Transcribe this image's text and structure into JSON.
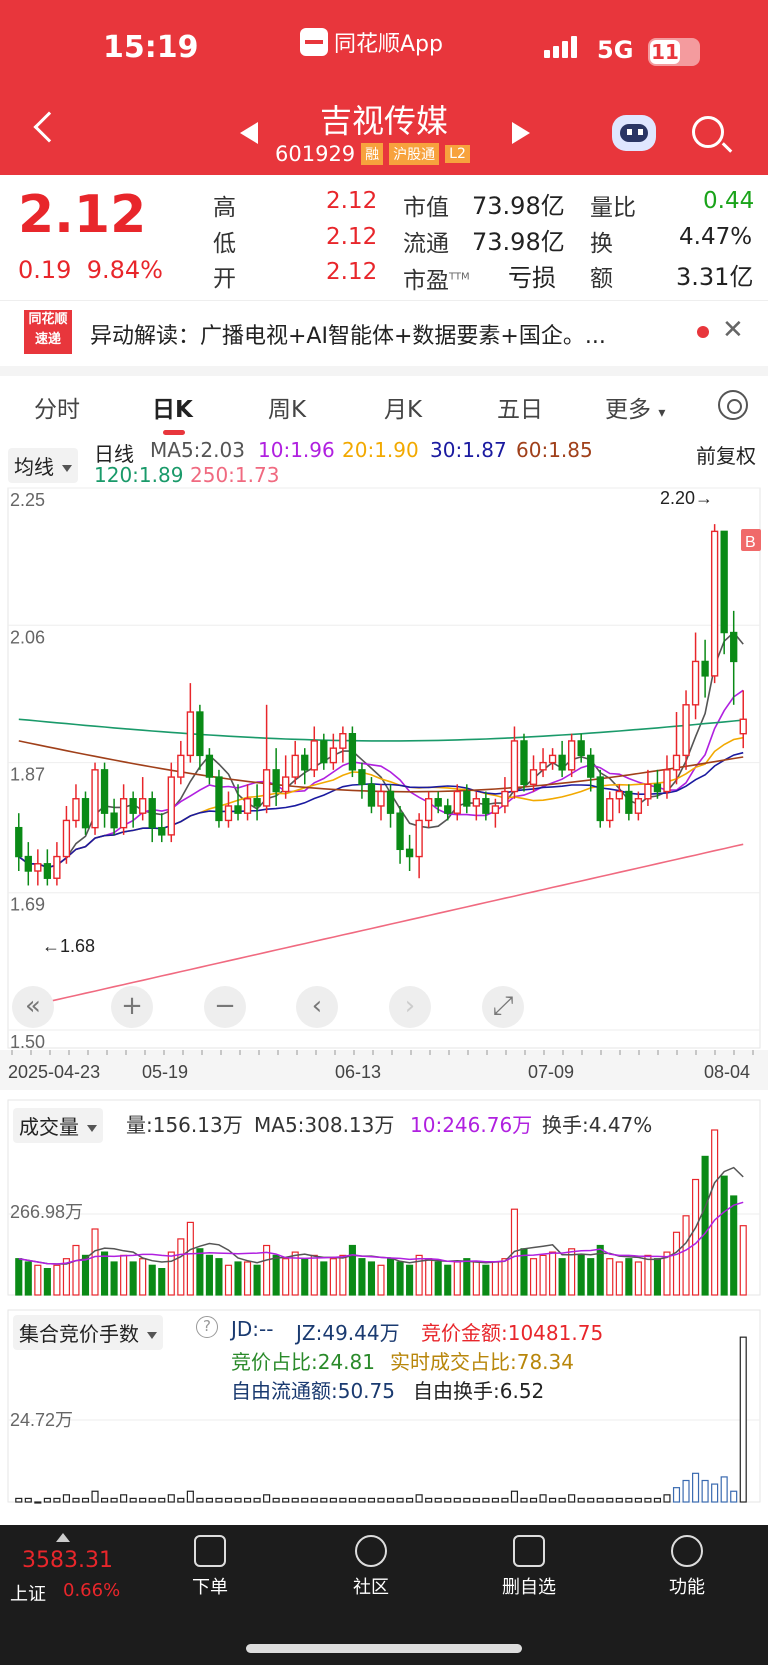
{
  "status": {
    "time": "15:19",
    "app_name": "同花顺App",
    "network": "5G",
    "battery": "11"
  },
  "stock": {
    "name": "吉视传媒",
    "code": "601929",
    "tags": [
      "融",
      "沪股通",
      "L2"
    ]
  },
  "quote": {
    "price": "2.12",
    "change": "0.19",
    "change_pct": "9.84%",
    "high_label": "高",
    "high": "2.12",
    "low_label": "低",
    "low": "2.12",
    "open_label": "开",
    "open": "2.12",
    "mcap_label": "市值",
    "mcap": "73.98亿",
    "float_label": "流通",
    "float": "73.98亿",
    "pe_label": "市盈",
    "pe_sup": "TTM",
    "pe": "亏损",
    "vr_label": "量比",
    "vr": "0.44",
    "turn_label": "换",
    "turn": "4.47%",
    "amt_label": "额",
    "amt": "3.31亿"
  },
  "news": {
    "logo_top": "同花顺",
    "logo_bottom": "速递",
    "text": "异动解读：广播电视+AI智能体+数据要素+国企。..."
  },
  "tabs": [
    "分时",
    "日K",
    "周K",
    "月K",
    "五日",
    "更多"
  ],
  "ma": {
    "selector": "均线",
    "period": "日线",
    "right": "前复权",
    "ma5": "MA5:2.03",
    "ma10": "10:1.96",
    "ma20": "20:1.90",
    "ma30": "30:1.87",
    "ma60": "60:1.85",
    "ma120": "120:1.89",
    "ma250": "250:1.73"
  },
  "kline": {
    "y_labels": [
      "2.25",
      "2.06",
      "1.87",
      "1.69",
      "1.50"
    ],
    "max_label": "2.20→",
    "min_label": "←1.68",
    "b_marker": "B",
    "dates": [
      "2025-04-23",
      "05-19",
      "06-13",
      "07-09",
      "08-04"
    ]
  },
  "volume": {
    "selector": "成交量",
    "vol": "量:156.13万",
    "ma5": "MA5:308.13万",
    "ma10": "10:246.76万",
    "turn": "换手:4.47%",
    "y_label": "266.98万"
  },
  "auction": {
    "selector": "集合竞价手数",
    "jd": "JD:--",
    "jz": "JZ:49.44万",
    "amount": "竞价金额:10481.75",
    "ratio": "竞价占比:24.81",
    "rt_ratio": "实时成交占比:78.34",
    "free_float": "自由流通额:50.75",
    "free_turn": "自由换手:6.52",
    "y_label": "24.72万"
  },
  "index": {
    "value": "3583.31",
    "name": "上证",
    "pct": "0.66%"
  },
  "nav": [
    "下单",
    "社区",
    "删自选",
    "功能"
  ],
  "colors": {
    "header": "#e8363c",
    "up": "#e8262b",
    "down": "#0a8a16"
  },
  "chart_data": {
    "type": "candlestick",
    "ylim": [
      1.5,
      2.25
    ],
    "max": 2.2,
    "min": 1.68,
    "candles": [
      [
        1.78,
        1.74,
        1.8,
        1.72
      ],
      [
        1.74,
        1.72,
        1.76,
        1.7
      ],
      [
        1.72,
        1.73,
        1.75,
        1.7
      ],
      [
        1.73,
        1.71,
        1.75,
        1.7
      ],
      [
        1.71,
        1.74,
        1.76,
        1.7
      ],
      [
        1.74,
        1.79,
        1.81,
        1.73
      ],
      [
        1.79,
        1.82,
        1.84,
        1.78
      ],
      [
        1.82,
        1.78,
        1.83,
        1.77
      ],
      [
        1.78,
        1.86,
        1.87,
        1.77
      ],
      [
        1.86,
        1.8,
        1.87,
        1.78
      ],
      [
        1.8,
        1.78,
        1.82,
        1.77
      ],
      [
        1.78,
        1.82,
        1.84,
        1.77
      ],
      [
        1.82,
        1.8,
        1.83,
        1.78
      ],
      [
        1.8,
        1.82,
        1.85,
        1.79
      ],
      [
        1.82,
        1.78,
        1.83,
        1.76
      ],
      [
        1.78,
        1.77,
        1.8,
        1.76
      ],
      [
        1.77,
        1.85,
        1.87,
        1.76
      ],
      [
        1.85,
        1.88,
        1.9,
        1.84
      ],
      [
        1.88,
        1.94,
        1.98,
        1.87
      ],
      [
        1.94,
        1.88,
        1.95,
        1.86
      ],
      [
        1.88,
        1.85,
        1.89,
        1.84
      ],
      [
        1.85,
        1.79,
        1.86,
        1.78
      ],
      [
        1.79,
        1.81,
        1.83,
        1.78
      ],
      [
        1.81,
        1.8,
        1.84,
        1.79
      ],
      [
        1.8,
        1.82,
        1.84,
        1.79
      ],
      [
        1.82,
        1.81,
        1.84,
        1.79
      ],
      [
        1.81,
        1.86,
        1.95,
        1.8
      ],
      [
        1.86,
        1.83,
        1.89,
        1.81
      ],
      [
        1.83,
        1.85,
        1.88,
        1.82
      ],
      [
        1.85,
        1.88,
        1.9,
        1.84
      ],
      [
        1.88,
        1.86,
        1.89,
        1.84
      ],
      [
        1.86,
        1.9,
        1.92,
        1.85
      ],
      [
        1.9,
        1.87,
        1.91,
        1.86
      ],
      [
        1.87,
        1.89,
        1.91,
        1.86
      ],
      [
        1.89,
        1.91,
        1.92,
        1.87
      ],
      [
        1.91,
        1.86,
        1.92,
        1.85
      ],
      [
        1.86,
        1.84,
        1.87,
        1.82
      ],
      [
        1.84,
        1.81,
        1.85,
        1.8
      ],
      [
        1.81,
        1.83,
        1.84,
        1.79
      ],
      [
        1.83,
        1.8,
        1.84,
        1.78
      ],
      [
        1.8,
        1.75,
        1.81,
        1.73
      ],
      [
        1.75,
        1.74,
        1.77,
        1.72
      ],
      [
        1.74,
        1.79,
        1.8,
        1.71
      ],
      [
        1.79,
        1.82,
        1.83,
        1.78
      ],
      [
        1.82,
        1.81,
        1.83,
        1.8
      ],
      [
        1.81,
        1.8,
        1.82,
        1.79
      ],
      [
        1.8,
        1.83,
        1.84,
        1.79
      ],
      [
        1.83,
        1.81,
        1.84,
        1.8
      ],
      [
        1.81,
        1.82,
        1.83,
        1.79
      ],
      [
        1.82,
        1.8,
        1.83,
        1.79
      ],
      [
        1.8,
        1.81,
        1.82,
        1.78
      ],
      [
        1.81,
        1.83,
        1.85,
        1.8
      ],
      [
        1.83,
        1.9,
        1.92,
        1.82
      ],
      [
        1.9,
        1.84,
        1.91,
        1.83
      ],
      [
        1.84,
        1.86,
        1.88,
        1.83
      ],
      [
        1.86,
        1.87,
        1.89,
        1.85
      ],
      [
        1.87,
        1.88,
        1.89,
        1.86
      ],
      [
        1.88,
        1.86,
        1.9,
        1.85
      ],
      [
        1.86,
        1.9,
        1.91,
        1.85
      ],
      [
        1.9,
        1.88,
        1.91,
        1.87
      ],
      [
        1.88,
        1.85,
        1.89,
        1.83
      ],
      [
        1.85,
        1.79,
        1.86,
        1.78
      ],
      [
        1.79,
        1.82,
        1.83,
        1.78
      ],
      [
        1.82,
        1.83,
        1.84,
        1.8
      ],
      [
        1.83,
        1.8,
        1.84,
        1.79
      ],
      [
        1.8,
        1.82,
        1.83,
        1.79
      ],
      [
        1.82,
        1.84,
        1.86,
        1.81
      ],
      [
        1.84,
        1.83,
        1.86,
        1.82
      ],
      [
        1.83,
        1.86,
        1.88,
        1.82
      ],
      [
        1.86,
        1.88,
        1.94,
        1.84
      ],
      [
        1.88,
        1.95,
        1.97,
        1.86
      ],
      [
        1.95,
        2.01,
        2.05,
        1.93
      ],
      [
        2.01,
        1.99,
        2.04,
        1.96
      ],
      [
        1.99,
        2.19,
        2.2,
        1.98
      ],
      [
        2.19,
        2.05,
        2.17,
        2.02
      ],
      [
        2.05,
        2.01,
        2.08,
        1.95
      ],
      [
        1.91,
        1.93,
        1.97,
        1.89
      ]
    ],
    "volume": [
      22,
      20,
      18,
      16,
      18,
      22,
      30,
      24,
      40,
      26,
      20,
      24,
      20,
      22,
      18,
      16,
      26,
      34,
      44,
      28,
      24,
      22,
      18,
      20,
      20,
      18,
      30,
      24,
      22,
      26,
      22,
      24,
      20,
      22,
      24,
      30,
      22,
      20,
      18,
      22,
      20,
      18,
      24,
      22,
      20,
      18,
      20,
      22,
      20,
      18,
      20,
      22,
      52,
      28,
      22,
      24,
      26,
      22,
      28,
      24,
      22,
      30,
      22,
      20,
      22,
      20,
      24,
      22,
      26,
      38,
      48,
      70,
      84,
      100,
      72,
      60,
      42
    ],
    "auction": [
      1,
      1,
      0,
      1,
      1,
      2,
      1,
      1,
      3,
      1,
      1,
      2,
      1,
      1,
      1,
      1,
      2,
      1,
      3,
      1,
      1,
      1,
      1,
      1,
      1,
      1,
      2,
      1,
      1,
      1,
      1,
      1,
      1,
      1,
      1,
      1,
      1,
      1,
      1,
      1,
      1,
      1,
      2,
      1,
      1,
      1,
      1,
      1,
      1,
      1,
      1,
      1,
      3,
      1,
      1,
      2,
      1,
      1,
      2,
      1,
      1,
      1,
      1,
      1,
      1,
      1,
      1,
      1,
      2,
      4,
      6,
      8,
      6,
      5,
      7,
      3,
      46
    ]
  }
}
